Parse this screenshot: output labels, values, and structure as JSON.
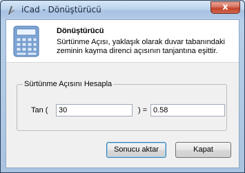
{
  "window": {
    "title": "iCad - Dönüştürücü",
    "close_glyph": "x"
  },
  "header": {
    "title": "Dönüştürücü",
    "description": "Sürtünme Açısı, yaklaşık olarak duvar tabanındaki zeminin kayma direnci açısının tanjantına eşittir.",
    "icon": "calculator-icon"
  },
  "group": {
    "title": "Sürtünme Açısını Hesapla",
    "tan_label": "Tan (",
    "equals_label": ") =",
    "angle_value": "30",
    "result_value": "0.58"
  },
  "buttons": {
    "apply_label": "Sonucu aktar",
    "close_label": "Kapat"
  },
  "colors": {
    "close_button": "#c1412a",
    "title_bar": "#bcd3ec",
    "default_button_border": "#3c7fb1"
  }
}
